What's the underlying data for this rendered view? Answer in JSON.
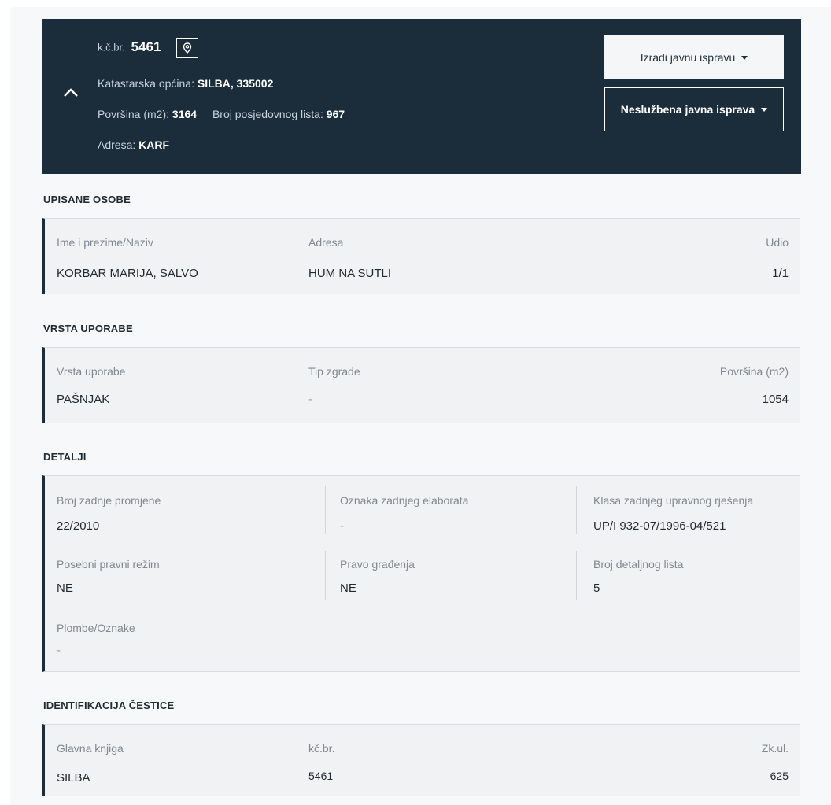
{
  "parcel": {
    "kcbr_label": "k.č.br.",
    "kcbr_value": "5461",
    "municipality_label": "Katastarska općina:",
    "municipality_value": "SILBA, 335002",
    "area_label": "Površina (m2):",
    "area_value": "3164",
    "possession_label": "Broj posjedovnog lista:",
    "possession_value": "967",
    "address_label": "Adresa:",
    "address_value": "KARF"
  },
  "actions": {
    "create_document": "Izradi javnu ispravu",
    "unofficial_document": "Neslužbena javna isprava"
  },
  "owners": {
    "title": "UPISANE OSOBE",
    "headers": [
      "Ime i prezime/Naziv",
      "Adresa",
      "Udio"
    ],
    "rows": [
      [
        "KORBAR MARIJA, SALVO",
        "HUM NA SUTLI",
        "1/1"
      ]
    ]
  },
  "usage": {
    "title": "VRSTA UPORABE",
    "headers": [
      "Vrsta uporabe",
      "Tip zgrade",
      "Površina (m2)"
    ],
    "rows": [
      [
        "PAŠNJAK",
        "-",
        "1054"
      ]
    ]
  },
  "details": {
    "title": "DETALJI",
    "items": [
      {
        "label": "Broj zadnje promjene",
        "value": "22/2010"
      },
      {
        "label": "Oznaka zadnjeg elaborata",
        "value": "-"
      },
      {
        "label": "Klasa zadnjeg upravnog rješenja",
        "value": "UP/I 932-07/1996-04/521"
      },
      {
        "label": "Posebni pravni režim",
        "value": "NE"
      },
      {
        "label": "Pravo građenja",
        "value": "NE"
      },
      {
        "label": "Broj detaljnog lista",
        "value": "5"
      },
      {
        "label": "Plombe/Oznake",
        "value": "-"
      }
    ]
  },
  "identification": {
    "title": "IDENTIFIKACIJA ČESTICE",
    "headers": [
      "Glavna knjiga",
      "kč.br.",
      "Zk.ul."
    ],
    "rows": [
      [
        "SILBA",
        "5461",
        "625"
      ]
    ]
  },
  "colors": {
    "header_bg": "#1b2d3b",
    "card_bg": "#f1f2f3",
    "accent_border": "#1b2d3b"
  },
  "icons": {
    "collapse": "chevron-up-icon",
    "location": "map-pin-icon",
    "dropdown": "caret-down-icon"
  }
}
